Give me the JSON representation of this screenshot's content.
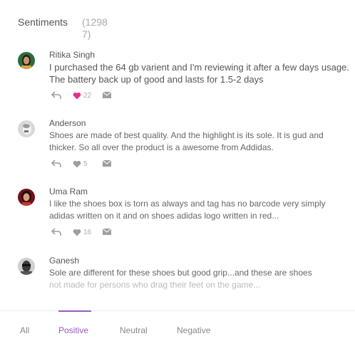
{
  "header": {
    "title": "Sentiments",
    "count": "(12987)"
  },
  "reviews": [
    {
      "name": "Ritika Singh",
      "text": "I purchased the 64 gb varient and I'm reviewing it after a few days usage. The battery back up of good and lasts for 1.5-2 days",
      "likes": "22",
      "liked": true
    },
    {
      "name": "Anderson",
      "text": "Shoes are made of best quality. And the highlight is its sole. It is gud and thicker. So all over the product is a awesome from Addidas.",
      "likes": "5",
      "liked": false
    },
    {
      "name": "Uma Ram",
      "text": "I like the shoes box is torn as always and tag has no barcode very simply adidas written on it and on shoes adidas logo written in red...",
      "likes": "16",
      "liked": false
    },
    {
      "name": "Ganesh",
      "text_line1": "Sole are different for these shoes but good grip...and these are shoes",
      "text_line2": "not made for persons who drag their feet on the game..."
    }
  ],
  "tabs": [
    {
      "label": "All"
    },
    {
      "label": "Positive"
    },
    {
      "label": "Neutral"
    },
    {
      "label": "Negative"
    }
  ],
  "active_tab": "Positive",
  "colors": {
    "accent": "#9b59b6",
    "heart_liked": "#e62e8a",
    "icon_gray": "#9e9e9e"
  }
}
